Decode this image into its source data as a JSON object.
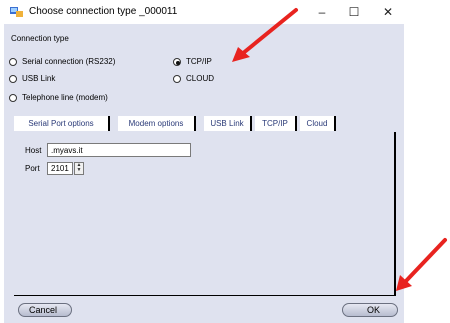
{
  "window": {
    "title": "Choose connection type _000011",
    "minimize": "–",
    "maximize": "☐",
    "close": "✕"
  },
  "connection_group": {
    "label": "Connection type",
    "options": [
      {
        "label": "Serial connection (RS232)",
        "checked": false
      },
      {
        "label": "USB Link",
        "checked": false
      },
      {
        "label": "Telephone line (modem)",
        "checked": false
      },
      {
        "label": "TCP/IP",
        "checked": true
      },
      {
        "label": "CLOUD",
        "checked": false
      }
    ]
  },
  "tabs": [
    {
      "label": "Serial Port options",
      "active": true
    },
    {
      "label": "Modem options",
      "active": false
    },
    {
      "label": "USB Link",
      "active": false
    },
    {
      "label": "TCP/IP",
      "active": false
    },
    {
      "label": "Cloud",
      "active": false
    }
  ],
  "fields": {
    "host_label": "Host",
    "host_value": ".myavs.it",
    "port_label": "Port",
    "port_value": "2101"
  },
  "buttons": {
    "cancel": "Cancel",
    "ok": "OK"
  },
  "annotation_color": "#e8231f"
}
